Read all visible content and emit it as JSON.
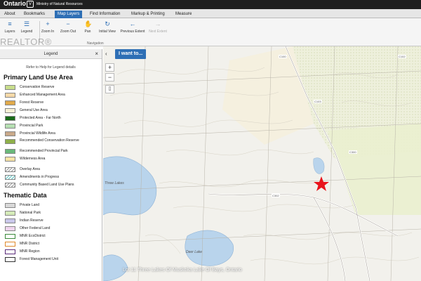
{
  "header": {
    "brand": "Ontario",
    "brand_mark": "V",
    "ministry": "Ministry of Natural Resources"
  },
  "tabs": [
    "About",
    "Bookmarks",
    "Map Layers",
    "Find Information",
    "Markup & Printing",
    "Measure"
  ],
  "active_tab": "Map Layers",
  "ribbon": {
    "buttons": [
      {
        "label": "Layers",
        "icon": "layers-icon",
        "glyph": "≡"
      },
      {
        "label": "Legend",
        "icon": "legend-icon",
        "glyph": "☰"
      },
      {
        "label": "Zoom In",
        "icon": "zoom-in-icon",
        "glyph": "+"
      },
      {
        "label": "Zoom Out",
        "icon": "zoom-out-icon",
        "glyph": "−"
      },
      {
        "label": "Pan",
        "icon": "pan-hand-icon",
        "glyph": "✋"
      },
      {
        "label": "Initial View",
        "icon": "initial-view-icon",
        "glyph": "↻"
      },
      {
        "label": "Previous Extent",
        "icon": "previous-extent-icon",
        "glyph": "←"
      },
      {
        "label": "Next Extent",
        "icon": "next-extent-icon",
        "glyph": "→"
      }
    ],
    "group_label": "Navigation"
  },
  "watermark": "REALTOR®",
  "legend": {
    "title": "Legend",
    "close": "×",
    "help": "Refer to Help for Legend details",
    "primary_title": "Primary Land Use Area",
    "primary_items": [
      {
        "label": "Conservation Reserve",
        "color": "#c8de8c",
        "pattern": "solid"
      },
      {
        "label": "Enhanced Management Area",
        "color": "#f6d9a8",
        "pattern": "solid"
      },
      {
        "label": "Forest Reserve",
        "color": "#e0a94a",
        "pattern": "solid"
      },
      {
        "label": "General Use Area",
        "color": "#f7f1d6",
        "pattern": "solid"
      },
      {
        "label": "Protected Area - Far North",
        "color": "#1a6b1a",
        "pattern": "solid"
      },
      {
        "label": "Provincial Park",
        "color": "#b6e0b3",
        "pattern": "solid"
      },
      {
        "label": "Provincial Wildlife Area",
        "color": "#c9a98a",
        "pattern": "solid"
      },
      {
        "label": "Recommended Conservation Reserve",
        "color": "#8fb04a",
        "pattern": "solid"
      },
      {
        "label": "Recommended Provincial Park",
        "color": "#6ab87a",
        "pattern": "solid"
      },
      {
        "label": "Wilderness Area",
        "color": "#f7e3a6",
        "pattern": "solid"
      }
    ],
    "overlay_items": [
      {
        "label": "Overlay Area",
        "color": "#999999",
        "pattern": "hatch"
      },
      {
        "label": "Amendments in Progress",
        "color": "#5bc0c0",
        "pattern": "hatch"
      },
      {
        "label": "Community Based Land Use Plans",
        "color": "#999999",
        "pattern": "hatch"
      }
    ],
    "thematic_title": "Thematic Data",
    "thematic_items": [
      {
        "label": "Private Land",
        "color": "#d9d9d9",
        "pattern": "solid"
      },
      {
        "label": "National Park",
        "color": "#d5ebb8",
        "pattern": "solid"
      },
      {
        "label": "Indian Reserve",
        "color": "#c9c7ea",
        "pattern": "solid"
      },
      {
        "label": "Other Federal Land",
        "color": "#f0d6ee",
        "pattern": "solid"
      },
      {
        "label": "MNR EcoDistrict",
        "color": "#ffffff",
        "pattern": "outline-green"
      },
      {
        "label": "MNR District",
        "color": "#ffffff",
        "pattern": "outline-orange"
      },
      {
        "label": "MNR Region",
        "color": "#ffffff",
        "pattern": "outline-purple"
      },
      {
        "label": "Forest Management Unit",
        "color": "#ffffff",
        "pattern": "outline-dark"
      }
    ]
  },
  "map": {
    "i_want_to": "I want to...",
    "collapse": "‹",
    "zoom_in": "+",
    "zoom_out": "−",
    "bookmark_icon": "book-icon",
    "marker_icon": "star-icon",
    "marker_color": "#e8141c",
    "lakes": [
      "Deer Lake",
      "Three Lakes"
    ],
    "road_labels": [
      "C100",
      "C102",
      "C103",
      "C300",
      "C302"
    ],
    "attribution": "Lot 11 Three Lakes Of Muskoka Lake Of Bays, Ontario"
  }
}
